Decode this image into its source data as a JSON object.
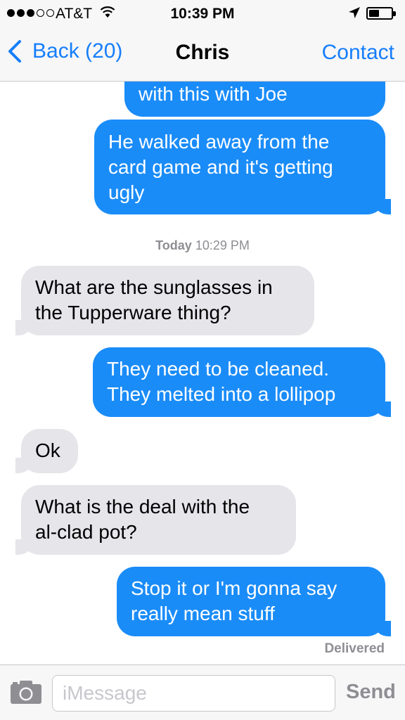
{
  "status_bar": {
    "carrier": "AT&T",
    "time": "10:39 PM",
    "signal_filled": 3,
    "signal_total": 5
  },
  "nav": {
    "back_label": "Back (20)",
    "title": "Chris",
    "contact_label": "Contact"
  },
  "messages": [
    {
      "from": "me",
      "lines": [
        "with this with Joe"
      ]
    },
    {
      "from": "me",
      "lines": [
        "He walked away from the",
        "card game and it's getting",
        "ugly"
      ]
    },
    {
      "from": "chris",
      "lines": [
        "What are the sunglasses in",
        "the Tupperware thing?"
      ]
    },
    {
      "from": "me",
      "lines": [
        "They need to be cleaned.",
        "They melted into a lollipop"
      ]
    },
    {
      "from": "chris",
      "lines": [
        "Ok"
      ]
    },
    {
      "from": "chris",
      "lines": [
        "What is the deal with the",
        "al-clad pot?"
      ]
    },
    {
      "from": "me",
      "lines": [
        "Stop it or I'm gonna say",
        "really mean stuff"
      ]
    }
  ],
  "timestamp": {
    "day": "Today",
    "time": "10:29 PM"
  },
  "delivered_label": "Delivered",
  "composer": {
    "placeholder": "iMessage",
    "send_label": "Send"
  },
  "colors": {
    "accent": "#157efb",
    "sent_bubble": "#1a8cf8",
    "received_bubble": "#e5e5ea"
  },
  "icons": [
    "wifi-icon",
    "location-arrow-icon",
    "battery-icon",
    "chevron-left-icon",
    "camera-icon"
  ]
}
